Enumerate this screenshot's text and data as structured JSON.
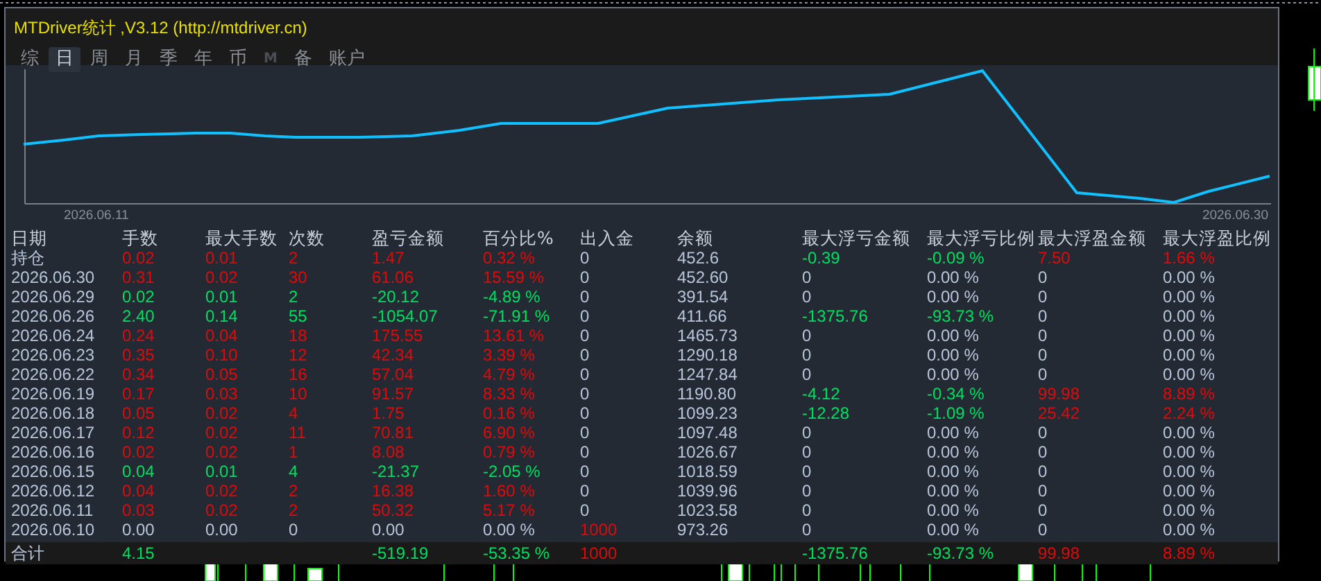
{
  "window": {
    "title": "MTDriver统计 ,V3.12 (http://mtdriver.cn)"
  },
  "tabs": [
    {
      "label": "综",
      "selected": false,
      "disabled": false
    },
    {
      "label": "日",
      "selected": true,
      "disabled": false
    },
    {
      "label": "周",
      "selected": false,
      "disabled": false
    },
    {
      "label": "月",
      "selected": false,
      "disabled": false
    },
    {
      "label": "季",
      "selected": false,
      "disabled": false
    },
    {
      "label": "年",
      "selected": false,
      "disabled": false
    },
    {
      "label": "币",
      "selected": false,
      "disabled": false
    },
    {
      "label": "M",
      "selected": false,
      "disabled": true
    },
    {
      "label": "备",
      "selected": false,
      "disabled": false
    },
    {
      "label": "账户",
      "selected": false,
      "disabled": false
    }
  ],
  "equity_chart": {
    "start_label": "2026.06.11",
    "end_label": "2026.06.30"
  },
  "table": {
    "columns": [
      "日期",
      "手数",
      "最大手数",
      "次数",
      "盈亏金额",
      "百分比%",
      "出入金",
      "余额",
      "最大浮亏金额",
      "最大浮亏比例",
      "最大浮盈金额",
      "最大浮盈比例"
    ],
    "rows": [
      {
        "cells": [
          {
            "text": "持仓",
            "color": "#b8c6dc"
          },
          {
            "text": "0.02",
            "color": "#e00a0a"
          },
          {
            "text": "0.01",
            "color": "#e00a0a"
          },
          {
            "text": "2",
            "color": "#e00a0a"
          },
          {
            "text": "1.47",
            "color": "#e00a0a"
          },
          {
            "text": "0.32 %",
            "color": "#e00a0a"
          },
          {
            "text": "0",
            "color": "#b8c6dc"
          },
          {
            "text": "452.6",
            "color": "#b8c6dc"
          },
          {
            "text": "-0.39",
            "color": "#00e060"
          },
          {
            "text": "-0.09 %",
            "color": "#00e060"
          },
          {
            "text": "7.50",
            "color": "#e00a0a"
          },
          {
            "text": "1.66 %",
            "color": "#e00a0a"
          }
        ]
      },
      {
        "cells": [
          {
            "text": "2026.06.30",
            "color": "#b8c6dc"
          },
          {
            "text": "0.31",
            "color": "#e00a0a"
          },
          {
            "text": "0.02",
            "color": "#e00a0a"
          },
          {
            "text": "30",
            "color": "#e00a0a"
          },
          {
            "text": "61.06",
            "color": "#e00a0a"
          },
          {
            "text": "15.59 %",
            "color": "#e00a0a"
          },
          {
            "text": "0",
            "color": "#b8c6dc"
          },
          {
            "text": "452.60",
            "color": "#b8c6dc"
          },
          {
            "text": "0",
            "color": "#b8c6dc"
          },
          {
            "text": "0.00 %",
            "color": "#b8c6dc"
          },
          {
            "text": "0",
            "color": "#b8c6dc"
          },
          {
            "text": "0.00 %",
            "color": "#b8c6dc"
          }
        ]
      },
      {
        "cells": [
          {
            "text": "2026.06.29",
            "color": "#b8c6dc"
          },
          {
            "text": "0.02",
            "color": "#00e060"
          },
          {
            "text": "0.01",
            "color": "#00e060"
          },
          {
            "text": "2",
            "color": "#00e060"
          },
          {
            "text": "-20.12",
            "color": "#00e060"
          },
          {
            "text": "-4.89 %",
            "color": "#00e060"
          },
          {
            "text": "0",
            "color": "#b8c6dc"
          },
          {
            "text": "391.54",
            "color": "#b8c6dc"
          },
          {
            "text": "0",
            "color": "#b8c6dc"
          },
          {
            "text": "0.00 %",
            "color": "#b8c6dc"
          },
          {
            "text": "0",
            "color": "#b8c6dc"
          },
          {
            "text": "0.00 %",
            "color": "#b8c6dc"
          }
        ]
      },
      {
        "cells": [
          {
            "text": "2026.06.26",
            "color": "#b8c6dc"
          },
          {
            "text": "2.40",
            "color": "#00e060"
          },
          {
            "text": "0.14",
            "color": "#00e060"
          },
          {
            "text": "55",
            "color": "#00e060"
          },
          {
            "text": "-1054.07",
            "color": "#00e060"
          },
          {
            "text": "-71.91 %",
            "color": "#00e060"
          },
          {
            "text": "0",
            "color": "#b8c6dc"
          },
          {
            "text": "411.66",
            "color": "#b8c6dc"
          },
          {
            "text": "-1375.76",
            "color": "#00e060"
          },
          {
            "text": "-93.73 %",
            "color": "#00e060"
          },
          {
            "text": "0",
            "color": "#b8c6dc"
          },
          {
            "text": "0.00 %",
            "color": "#b8c6dc"
          }
        ]
      },
      {
        "cells": [
          {
            "text": "2026.06.24",
            "color": "#b8c6dc"
          },
          {
            "text": "0.24",
            "color": "#e00a0a"
          },
          {
            "text": "0.04",
            "color": "#e00a0a"
          },
          {
            "text": "18",
            "color": "#e00a0a"
          },
          {
            "text": "175.55",
            "color": "#e00a0a"
          },
          {
            "text": "13.61 %",
            "color": "#e00a0a"
          },
          {
            "text": "0",
            "color": "#b8c6dc"
          },
          {
            "text": "1465.73",
            "color": "#b8c6dc"
          },
          {
            "text": "0",
            "color": "#b8c6dc"
          },
          {
            "text": "0.00 %",
            "color": "#b8c6dc"
          },
          {
            "text": "0",
            "color": "#b8c6dc"
          },
          {
            "text": "0.00 %",
            "color": "#b8c6dc"
          }
        ]
      },
      {
        "cells": [
          {
            "text": "2026.06.23",
            "color": "#b8c6dc"
          },
          {
            "text": "0.35",
            "color": "#e00a0a"
          },
          {
            "text": "0.10",
            "color": "#e00a0a"
          },
          {
            "text": "12",
            "color": "#e00a0a"
          },
          {
            "text": "42.34",
            "color": "#e00a0a"
          },
          {
            "text": "3.39 %",
            "color": "#e00a0a"
          },
          {
            "text": "0",
            "color": "#b8c6dc"
          },
          {
            "text": "1290.18",
            "color": "#b8c6dc"
          },
          {
            "text": "0",
            "color": "#b8c6dc"
          },
          {
            "text": "0.00 %",
            "color": "#b8c6dc"
          },
          {
            "text": "0",
            "color": "#b8c6dc"
          },
          {
            "text": "0.00 %",
            "color": "#b8c6dc"
          }
        ]
      },
      {
        "cells": [
          {
            "text": "2026.06.22",
            "color": "#b8c6dc"
          },
          {
            "text": "0.34",
            "color": "#e00a0a"
          },
          {
            "text": "0.05",
            "color": "#e00a0a"
          },
          {
            "text": "16",
            "color": "#e00a0a"
          },
          {
            "text": "57.04",
            "color": "#e00a0a"
          },
          {
            "text": "4.79 %",
            "color": "#e00a0a"
          },
          {
            "text": "0",
            "color": "#b8c6dc"
          },
          {
            "text": "1247.84",
            "color": "#b8c6dc"
          },
          {
            "text": "0",
            "color": "#b8c6dc"
          },
          {
            "text": "0.00 %",
            "color": "#b8c6dc"
          },
          {
            "text": "0",
            "color": "#b8c6dc"
          },
          {
            "text": "0.00 %",
            "color": "#b8c6dc"
          }
        ]
      },
      {
        "cells": [
          {
            "text": "2026.06.19",
            "color": "#b8c6dc"
          },
          {
            "text": "0.17",
            "color": "#e00a0a"
          },
          {
            "text": "0.03",
            "color": "#e00a0a"
          },
          {
            "text": "10",
            "color": "#e00a0a"
          },
          {
            "text": "91.57",
            "color": "#e00a0a"
          },
          {
            "text": "8.33 %",
            "color": "#e00a0a"
          },
          {
            "text": "0",
            "color": "#b8c6dc"
          },
          {
            "text": "1190.80",
            "color": "#b8c6dc"
          },
          {
            "text": "-4.12",
            "color": "#00e060"
          },
          {
            "text": "-0.34 %",
            "color": "#00e060"
          },
          {
            "text": "99.98",
            "color": "#e00a0a"
          },
          {
            "text": "8.89 %",
            "color": "#e00a0a"
          }
        ]
      },
      {
        "cells": [
          {
            "text": "2026.06.18",
            "color": "#b8c6dc"
          },
          {
            "text": "0.05",
            "color": "#e00a0a"
          },
          {
            "text": "0.02",
            "color": "#e00a0a"
          },
          {
            "text": "4",
            "color": "#e00a0a"
          },
          {
            "text": "1.75",
            "color": "#e00a0a"
          },
          {
            "text": "0.16 %",
            "color": "#e00a0a"
          },
          {
            "text": "0",
            "color": "#b8c6dc"
          },
          {
            "text": "1099.23",
            "color": "#b8c6dc"
          },
          {
            "text": "-12.28",
            "color": "#00e060"
          },
          {
            "text": "-1.09 %",
            "color": "#00e060"
          },
          {
            "text": "25.42",
            "color": "#e00a0a"
          },
          {
            "text": "2.24 %",
            "color": "#e00a0a"
          }
        ]
      },
      {
        "cells": [
          {
            "text": "2026.06.17",
            "color": "#b8c6dc"
          },
          {
            "text": "0.12",
            "color": "#e00a0a"
          },
          {
            "text": "0.02",
            "color": "#e00a0a"
          },
          {
            "text": "11",
            "color": "#e00a0a"
          },
          {
            "text": "70.81",
            "color": "#e00a0a"
          },
          {
            "text": "6.90 %",
            "color": "#e00a0a"
          },
          {
            "text": "0",
            "color": "#b8c6dc"
          },
          {
            "text": "1097.48",
            "color": "#b8c6dc"
          },
          {
            "text": "0",
            "color": "#b8c6dc"
          },
          {
            "text": "0.00 %",
            "color": "#b8c6dc"
          },
          {
            "text": "0",
            "color": "#b8c6dc"
          },
          {
            "text": "0.00 %",
            "color": "#b8c6dc"
          }
        ]
      },
      {
        "cells": [
          {
            "text": "2026.06.16",
            "color": "#b8c6dc"
          },
          {
            "text": "0.02",
            "color": "#e00a0a"
          },
          {
            "text": "0.02",
            "color": "#e00a0a"
          },
          {
            "text": "1",
            "color": "#e00a0a"
          },
          {
            "text": "8.08",
            "color": "#e00a0a"
          },
          {
            "text": "0.79 %",
            "color": "#e00a0a"
          },
          {
            "text": "0",
            "color": "#b8c6dc"
          },
          {
            "text": "1026.67",
            "color": "#b8c6dc"
          },
          {
            "text": "0",
            "color": "#b8c6dc"
          },
          {
            "text": "0.00 %",
            "color": "#b8c6dc"
          },
          {
            "text": "0",
            "color": "#b8c6dc"
          },
          {
            "text": "0.00 %",
            "color": "#b8c6dc"
          }
        ]
      },
      {
        "cells": [
          {
            "text": "2026.06.15",
            "color": "#b8c6dc"
          },
          {
            "text": "0.04",
            "color": "#00e060"
          },
          {
            "text": "0.01",
            "color": "#00e060"
          },
          {
            "text": "4",
            "color": "#00e060"
          },
          {
            "text": "-21.37",
            "color": "#00e060"
          },
          {
            "text": "-2.05 %",
            "color": "#00e060"
          },
          {
            "text": "0",
            "color": "#b8c6dc"
          },
          {
            "text": "1018.59",
            "color": "#b8c6dc"
          },
          {
            "text": "0",
            "color": "#b8c6dc"
          },
          {
            "text": "0.00 %",
            "color": "#b8c6dc"
          },
          {
            "text": "0",
            "color": "#b8c6dc"
          },
          {
            "text": "0.00 %",
            "color": "#b8c6dc"
          }
        ]
      },
      {
        "cells": [
          {
            "text": "2026.06.12",
            "color": "#b8c6dc"
          },
          {
            "text": "0.04",
            "color": "#e00a0a"
          },
          {
            "text": "0.02",
            "color": "#e00a0a"
          },
          {
            "text": "2",
            "color": "#e00a0a"
          },
          {
            "text": "16.38",
            "color": "#e00a0a"
          },
          {
            "text": "1.60 %",
            "color": "#e00a0a"
          },
          {
            "text": "0",
            "color": "#b8c6dc"
          },
          {
            "text": "1039.96",
            "color": "#b8c6dc"
          },
          {
            "text": "0",
            "color": "#b8c6dc"
          },
          {
            "text": "0.00 %",
            "color": "#b8c6dc"
          },
          {
            "text": "0",
            "color": "#b8c6dc"
          },
          {
            "text": "0.00 %",
            "color": "#b8c6dc"
          }
        ]
      },
      {
        "cells": [
          {
            "text": "2026.06.11",
            "color": "#b8c6dc"
          },
          {
            "text": "0.03",
            "color": "#e00a0a"
          },
          {
            "text": "0.02",
            "color": "#e00a0a"
          },
          {
            "text": "2",
            "color": "#e00a0a"
          },
          {
            "text": "50.32",
            "color": "#e00a0a"
          },
          {
            "text": "5.17 %",
            "color": "#e00a0a"
          },
          {
            "text": "0",
            "color": "#b8c6dc"
          },
          {
            "text": "1023.58",
            "color": "#b8c6dc"
          },
          {
            "text": "0",
            "color": "#b8c6dc"
          },
          {
            "text": "0.00 %",
            "color": "#b8c6dc"
          },
          {
            "text": "0",
            "color": "#b8c6dc"
          },
          {
            "text": "0.00 %",
            "color": "#b8c6dc"
          }
        ]
      },
      {
        "cells": [
          {
            "text": "2026.06.10",
            "color": "#b8c6dc"
          },
          {
            "text": "0.00",
            "color": "#b8c6dc"
          },
          {
            "text": "0.00",
            "color": "#b8c6dc"
          },
          {
            "text": "0",
            "color": "#b8c6dc"
          },
          {
            "text": "0.00",
            "color": "#b8c6dc"
          },
          {
            "text": "0.00 %",
            "color": "#b8c6dc"
          },
          {
            "text": "1000",
            "color": "#e00a0a"
          },
          {
            "text": "973.26",
            "color": "#b8c6dc"
          },
          {
            "text": "0",
            "color": "#b8c6dc"
          },
          {
            "text": "0.00 %",
            "color": "#b8c6dc"
          },
          {
            "text": "0",
            "color": "#b8c6dc"
          },
          {
            "text": "0.00 %",
            "color": "#b8c6dc"
          }
        ]
      }
    ],
    "total": {
      "cells": [
        {
          "text": "合计",
          "color": "#b8c6dc"
        },
        {
          "text": "4.15",
          "color": "#00e060"
        },
        null,
        null,
        {
          "text": "-519.19",
          "color": "#00e060"
        },
        {
          "text": "-53.35 %",
          "color": "#00e060"
        },
        {
          "text": "1000",
          "color": "#e00a0a"
        },
        null,
        {
          "text": "-1375.76",
          "color": "#00e060"
        },
        {
          "text": "-93.73 %",
          "color": "#00e060"
        },
        {
          "text": "99.98",
          "color": "#e00a0a"
        },
        {
          "text": "8.89 %",
          "color": "#e00a0a"
        }
      ]
    }
  }
}
